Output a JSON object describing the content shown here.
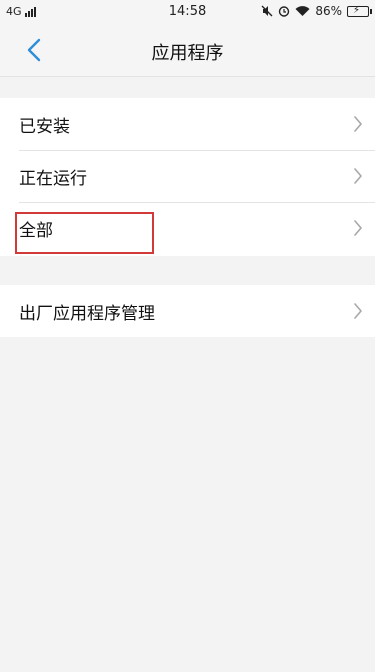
{
  "status_bar": {
    "network": "4G",
    "time": "14:58",
    "battery": "86%"
  },
  "header": {
    "title": "应用程序",
    "back_icon": "chevron-left-icon"
  },
  "menu": {
    "group1": [
      {
        "label": "已安装"
      },
      {
        "label": "正在运行"
      },
      {
        "label": "全部"
      }
    ],
    "group2": [
      {
        "label": "出厂应用程序管理"
      }
    ]
  },
  "colors": {
    "accent": "#2f8fd6",
    "highlight": "#d23a3a",
    "background": "#f3f3f3"
  }
}
